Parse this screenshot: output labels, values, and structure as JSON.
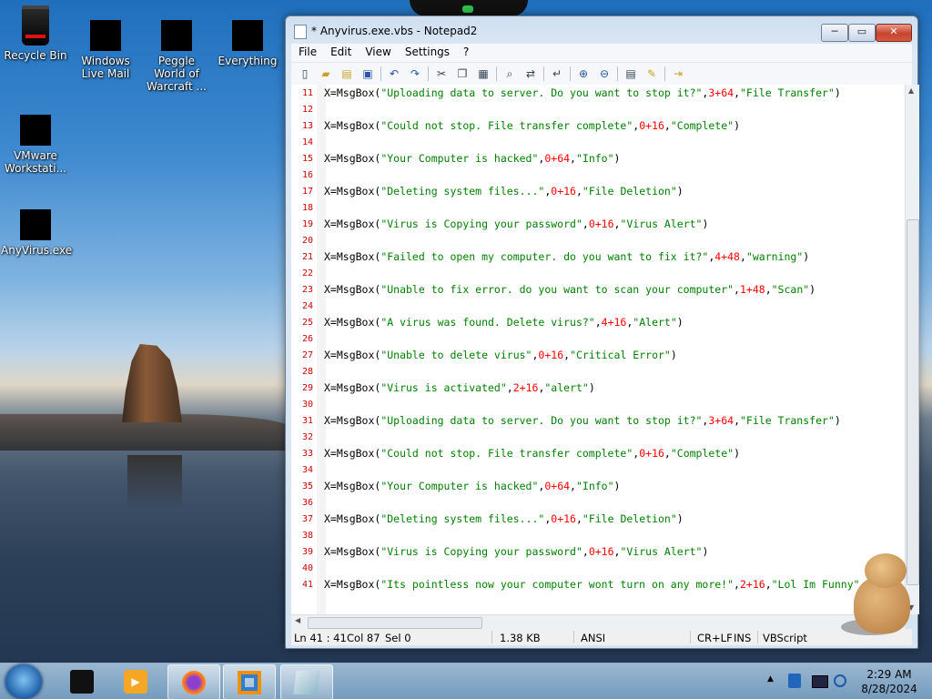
{
  "desktop": {
    "icons": [
      {
        "label": "Recycle Bin"
      },
      {
        "label": "Windows Live Mail"
      },
      {
        "label": "Peggle World of Warcraft ..."
      },
      {
        "label": "Everything"
      },
      {
        "label": "VMware Workstati..."
      },
      {
        "label": "AnyVirus.exe"
      }
    ]
  },
  "window": {
    "title": "* Anyvirus.exe.vbs - Notepad2",
    "minimize": "─",
    "maximize": "▭",
    "close": "✕"
  },
  "menu": [
    "File",
    "Edit",
    "View",
    "Settings",
    "?"
  ],
  "toolbar_icons": [
    "new-file-icon",
    "open-file-icon",
    "browse-icon",
    "save-icon",
    "undo-icon",
    "redo-icon",
    "cut-icon",
    "copy-icon",
    "paste-icon",
    "find-icon",
    "replace-icon",
    "word-wrap-icon",
    "zoom-in-icon",
    "zoom-out-icon",
    "scheme-icon",
    "customize-icon",
    "exit-icon"
  ],
  "editor": {
    "lines": [
      {
        "n": "11",
        "pre": "X=MsgBox(",
        "s1": "\"Uploading data to server. Do you want to stop it?\"",
        "m": ",",
        "num": "3+64",
        "m2": ",",
        "s2": "\"File Transfer\"",
        "post": ")"
      },
      {
        "n": "12",
        "pre": "",
        "s1": "",
        "m": "",
        "num": "",
        "m2": "",
        "s2": "",
        "post": ""
      },
      {
        "n": "13",
        "pre": "X=MsgBox(",
        "s1": "\"Could not stop. File transfer complete\"",
        "m": ",",
        "num": "0+16",
        "m2": ",",
        "s2": "\"Complete\"",
        "post": ")"
      },
      {
        "n": "14",
        "pre": "",
        "s1": "",
        "m": "",
        "num": "",
        "m2": "",
        "s2": "",
        "post": ""
      },
      {
        "n": "15",
        "pre": "X=MsgBox(",
        "s1": "\"Your Computer is hacked\"",
        "m": ",",
        "num": "0+64",
        "m2": ",",
        "s2": "\"Info\"",
        "post": ")"
      },
      {
        "n": "16",
        "pre": "",
        "s1": "",
        "m": "",
        "num": "",
        "m2": "",
        "s2": "",
        "post": ""
      },
      {
        "n": "17",
        "pre": "X=MsgBox(",
        "s1": "\"Deleting system files...\"",
        "m": ",",
        "num": "0+16",
        "m2": ",",
        "s2": "\"File Deletion\"",
        "post": ")"
      },
      {
        "n": "18",
        "pre": "",
        "s1": "",
        "m": "",
        "num": "",
        "m2": "",
        "s2": "",
        "post": ""
      },
      {
        "n": "19",
        "pre": "X=MsgBox(",
        "s1": "\"Virus is Copying your password\"",
        "m": ",",
        "num": "0+16",
        "m2": ",",
        "s2": "\"Virus Alert\"",
        "post": ")"
      },
      {
        "n": "20",
        "pre": "",
        "s1": "",
        "m": "",
        "num": "",
        "m2": "",
        "s2": "",
        "post": ""
      },
      {
        "n": "21",
        "pre": "X=MsgBox(",
        "s1": "\"Failed to open my computer. do you want to fix it?\"",
        "m": ",",
        "num": "4+48",
        "m2": ",",
        "s2": "\"warning\"",
        "post": ")"
      },
      {
        "n": "22",
        "pre": "",
        "s1": "",
        "m": "",
        "num": "",
        "m2": "",
        "s2": "",
        "post": ""
      },
      {
        "n": "23",
        "pre": "X=MsgBox(",
        "s1": "\"Unable to fix error. do you want to scan your computer\"",
        "m": ",",
        "num": "1+48",
        "m2": ",",
        "s2": "\"Scan\"",
        "post": ")"
      },
      {
        "n": "24",
        "pre": "",
        "s1": "",
        "m": "",
        "num": "",
        "m2": "",
        "s2": "",
        "post": ""
      },
      {
        "n": "25",
        "pre": "X=MsgBox(",
        "s1": "\"A virus was found. Delete virus?\"",
        "m": ",",
        "num": "4+16",
        "m2": ",",
        "s2": "\"Alert\"",
        "post": ")"
      },
      {
        "n": "26",
        "pre": "",
        "s1": "",
        "m": "",
        "num": "",
        "m2": "",
        "s2": "",
        "post": ""
      },
      {
        "n": "27",
        "pre": "X=MsgBox(",
        "s1": "\"Unable to delete virus\"",
        "m": ",",
        "num": "0+16",
        "m2": ",",
        "s2": "\"Critical Error\"",
        "post": ")"
      },
      {
        "n": "28",
        "pre": "",
        "s1": "",
        "m": "",
        "num": "",
        "m2": "",
        "s2": "",
        "post": ""
      },
      {
        "n": "29",
        "pre": "X=MsgBox(",
        "s1": "\"Virus is activated\"",
        "m": ",",
        "num": "2+16",
        "m2": ",",
        "s2": "\"alert\"",
        "post": ")"
      },
      {
        "n": "30",
        "pre": "",
        "s1": "",
        "m": "",
        "num": "",
        "m2": "",
        "s2": "",
        "post": ""
      },
      {
        "n": "31",
        "pre": "X=MsgBox(",
        "s1": "\"Uploading data to server. Do you want to stop it?\"",
        "m": ",",
        "num": "3+64",
        "m2": ",",
        "s2": "\"File Transfer\"",
        "post": ")"
      },
      {
        "n": "32",
        "pre": "",
        "s1": "",
        "m": "",
        "num": "",
        "m2": "",
        "s2": "",
        "post": ""
      },
      {
        "n": "33",
        "pre": "X=MsgBox(",
        "s1": "\"Could not stop. File transfer complete\"",
        "m": ",",
        "num": "0+16",
        "m2": ",",
        "s2": "\"Complete\"",
        "post": ")"
      },
      {
        "n": "34",
        "pre": "",
        "s1": "",
        "m": "",
        "num": "",
        "m2": "",
        "s2": "",
        "post": ""
      },
      {
        "n": "35",
        "pre": "X=MsgBox(",
        "s1": "\"Your Computer is hacked\"",
        "m": ",",
        "num": "0+64",
        "m2": ",",
        "s2": "\"Info\"",
        "post": ")"
      },
      {
        "n": "36",
        "pre": "",
        "s1": "",
        "m": "",
        "num": "",
        "m2": "",
        "s2": "",
        "post": ""
      },
      {
        "n": "37",
        "pre": "X=MsgBox(",
        "s1": "\"Deleting system files...\"",
        "m": ",",
        "num": "0+16",
        "m2": ",",
        "s2": "\"File Deletion\"",
        "post": ")"
      },
      {
        "n": "38",
        "pre": "",
        "s1": "",
        "m": "",
        "num": "",
        "m2": "",
        "s2": "",
        "post": ""
      },
      {
        "n": "39",
        "pre": "X=MsgBox(",
        "s1": "\"Virus is Copying your password\"",
        "m": ",",
        "num": "0+16",
        "m2": ",",
        "s2": "\"Virus Alert\"",
        "post": ")"
      },
      {
        "n": "40",
        "pre": "",
        "s1": "",
        "m": "",
        "num": "",
        "m2": "",
        "s2": "",
        "post": ""
      },
      {
        "n": "41",
        "pre": "X=MsgBox(",
        "s1": "\"Its pointless now your computer wont turn on any more!\"",
        "m": ",",
        "num": "2+16",
        "m2": ",",
        "s2": "\"Lol Im Funny\"",
        "post": ""
      }
    ]
  },
  "statusbar": {
    "position": "Ln 41 : 41",
    "col": "Col 87",
    "sel": "Sel 0",
    "size": "1.38 KB",
    "encoding": "ANSI",
    "eol": "CR+LF",
    "mode": "INS",
    "scheme": "VBScript"
  },
  "taskbar": {
    "apps": [
      "cube-app-icon",
      "media-player-icon",
      "firefox-icon",
      "vmware-icon",
      "notepad2-icon"
    ],
    "tray_arrow": "▲",
    "time": "2:29 AM",
    "date": "8/28/2024"
  },
  "colors": {
    "string": "#008000",
    "number": "#ff0000",
    "line_number": "#cc0000"
  }
}
